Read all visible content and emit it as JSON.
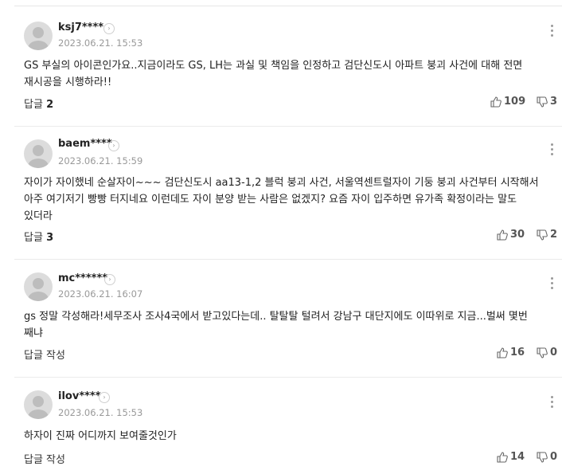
{
  "comments": [
    {
      "nickname": "ksj7****",
      "date": "2023.06.21. 15:53",
      "lines": [
        "GS 부실의 아이콘인가요..지금이라도 GS, LH는 과실 및 책임을 인정하고 검단신도시 아파트 붕괴 사건에 대해 전면",
        "재시공을 시행하라!!"
      ],
      "reply_label": "답글",
      "reply_count": "2",
      "likes": "109",
      "dislikes": "3"
    },
    {
      "nickname": "baem****",
      "date": "2023.06.21. 15:59",
      "lines": [
        "자이가 자이했네 순살자이~~~ 검단신도시 aa13-1,2 블럭 붕괴 사건, 서울역센트럴자이 기둥 붕괴 사건부터 시작해서",
        "아주 여기저기 빵빵 터지네요 이런데도 자이 분양 받는 사람은 없겠지? 요즘 자이 입주하면 유가족 확정이라는 말도",
        "있더라"
      ],
      "reply_label": "답글",
      "reply_count": "3",
      "likes": "30",
      "dislikes": "2"
    },
    {
      "nickname": "mc******",
      "date": "2023.06.21. 16:07",
      "lines": [
        "gs 정말 각성해라!세무조사 조사4국에서 받고있다는데.. 탈탈탈 털려서 강남구 대단지에도 이따위로 지금...벌써 몇번",
        "째냐"
      ],
      "reply_label": "답글 작성",
      "reply_count": "",
      "likes": "16",
      "dislikes": "0"
    },
    {
      "nickname": "ilov****",
      "date": "2023.06.21. 15:53",
      "lines": [
        "하자이 진짜 어디까지 보여줄것인가"
      ],
      "reply_label": "답글 작성",
      "reply_count": "",
      "likes": "14",
      "dislikes": "0"
    }
  ]
}
